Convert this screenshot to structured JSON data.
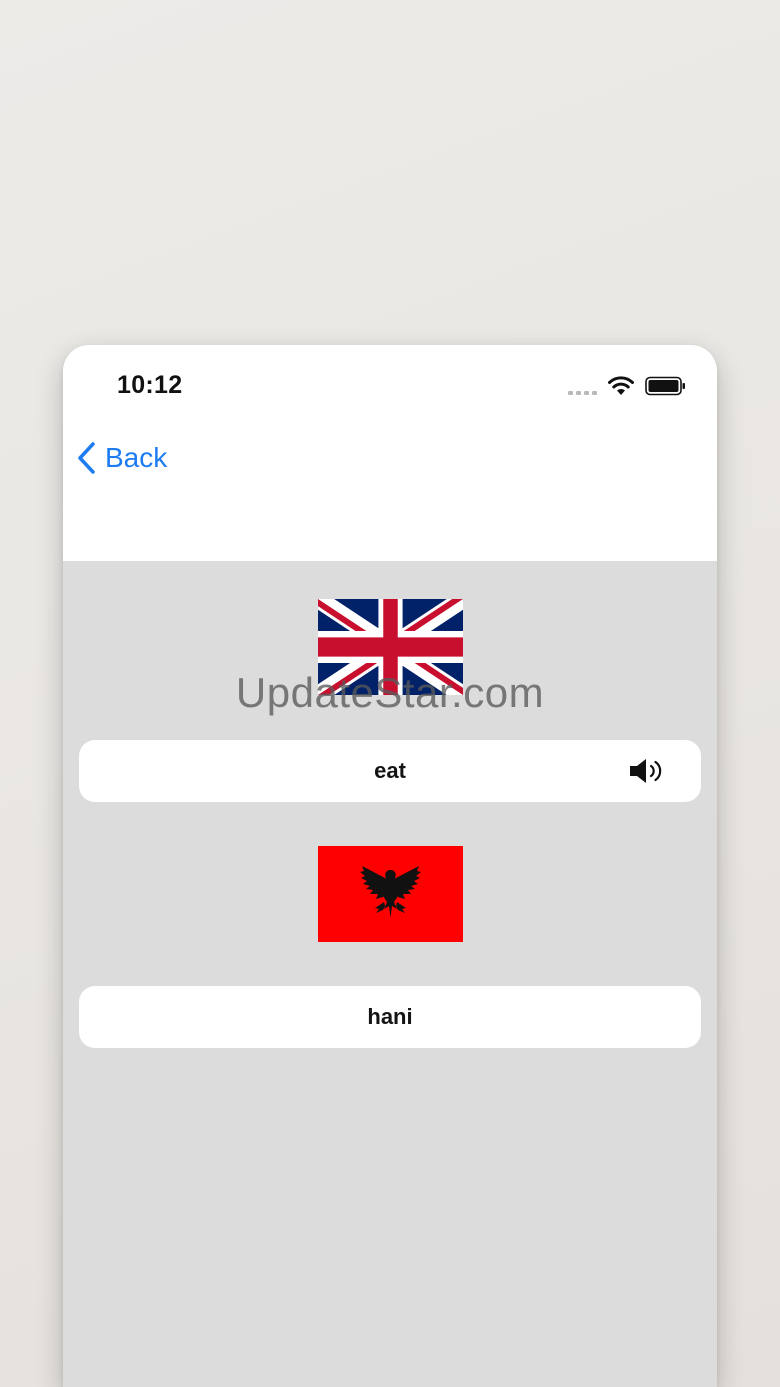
{
  "status_bar": {
    "time": "10:12",
    "icons": [
      "signal-dots-icon",
      "wifi-icon",
      "battery-icon"
    ]
  },
  "navigation": {
    "back_label": "Back",
    "back_icon": "chevron-left-icon"
  },
  "watermark": "UpdateStar.com",
  "source_language": {
    "flag_icon": "uk-flag-icon",
    "word": "eat",
    "audio_icon": "speaker-icon"
  },
  "target_language": {
    "flag_icon": "albania-flag-icon",
    "word": "hani"
  },
  "colors": {
    "accent": "#1d7cf2",
    "card_background": "#ffffff",
    "content_background": "#dcdcdc",
    "albania_red": "#ff0000",
    "uk_blue": "#012169",
    "uk_red": "#c8102e"
  }
}
